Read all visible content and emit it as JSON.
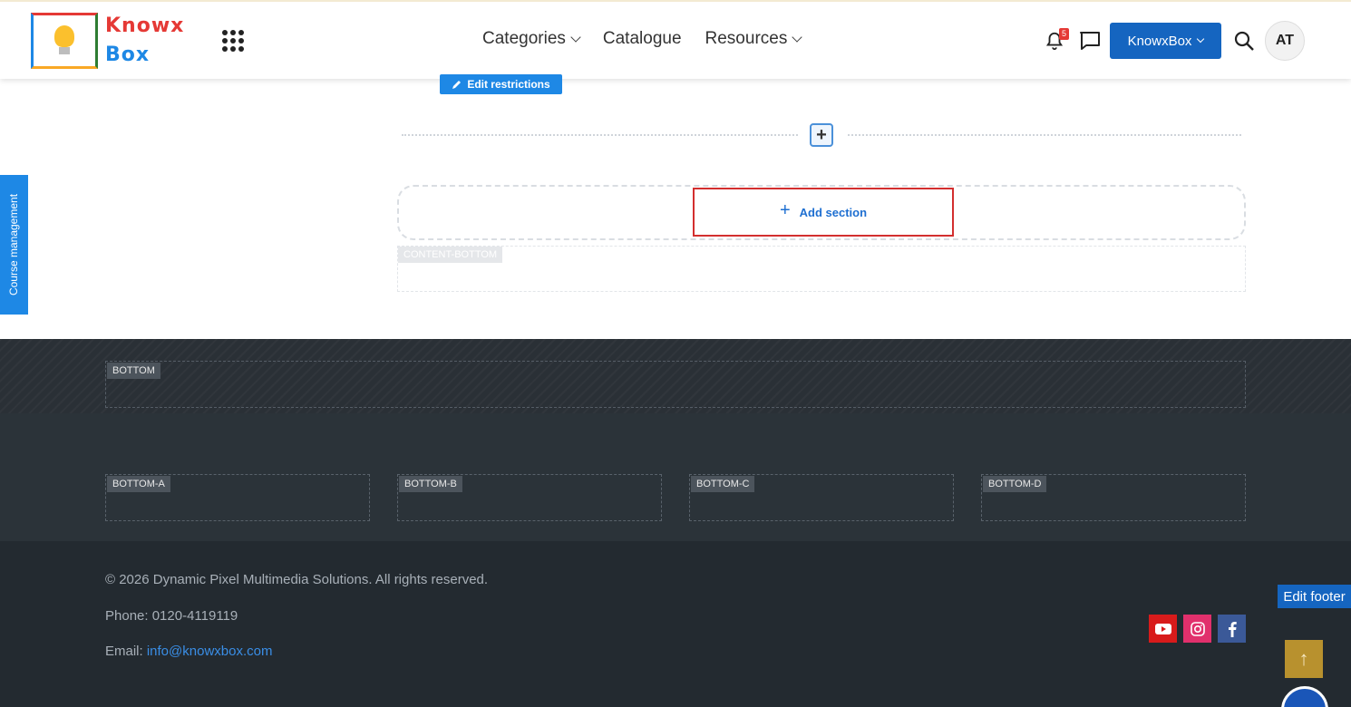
{
  "header": {
    "logo_line1": "Knowx",
    "logo_line2": "Box",
    "nav": [
      {
        "label": "Categories",
        "has_dropdown": true
      },
      {
        "label": "Catalogue",
        "has_dropdown": false
      },
      {
        "label": "Resources",
        "has_dropdown": true
      }
    ],
    "notification_count": "5",
    "account_button": "KnowxBox",
    "avatar_initials": "AT",
    "icons": [
      "apps-grid-icon",
      "bell-icon",
      "chat-icon",
      "search-icon",
      "chevron-down-icon"
    ]
  },
  "content": {
    "edit_restrictions_label": "Edit restrictions",
    "insert_symbol": "+",
    "add_section_label": "Add section",
    "content_bottom_label": "CONTENT-BOTTOM",
    "sidebar_tab_label": "Course management"
  },
  "bottom": {
    "bottom_label": "BOTTOM",
    "columns": [
      "BOTTOM-A",
      "BOTTOM-B",
      "BOTTOM-C",
      "BOTTOM-D"
    ]
  },
  "footer": {
    "copyright": "© 2026 Dynamic Pixel Multimedia Solutions. All rights reserved.",
    "phone": "Phone: 0120-4119119",
    "email_label": "Email: ",
    "email_link": "info@knowxbox.com",
    "edit_footer_label": "Edit footer",
    "social": [
      "youtube-icon",
      "instagram-icon",
      "facebook-icon"
    ],
    "to_top_symbol": "↑"
  },
  "colors": {
    "primary_blue": "#1565c0",
    "highlight_red": "#d32f2f",
    "footer_dark": "#232a30",
    "to_top_gold": "#b8912e"
  }
}
